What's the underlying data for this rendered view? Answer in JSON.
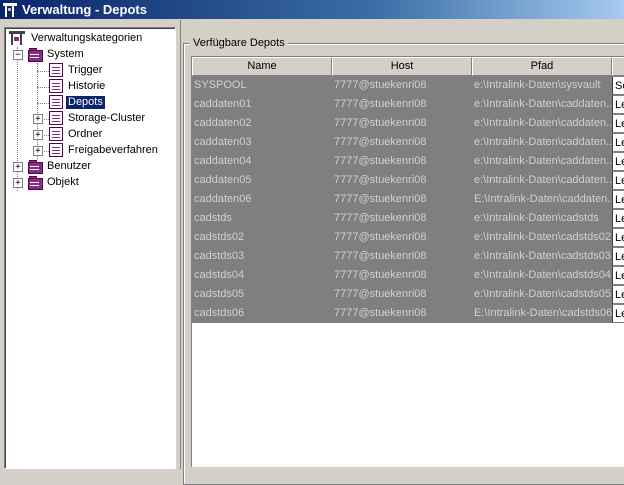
{
  "window": {
    "title": "Verwaltung - Depots"
  },
  "tree": {
    "root": "Verwaltungskategorien",
    "system": "System",
    "system_children": [
      "Trigger",
      "Historie",
      "Depots",
      "Storage-Cluster",
      "Ordner",
      "Freigabeverfahren"
    ],
    "selected": "Depots",
    "benutzer": "Benutzer",
    "objekt": "Objekt"
  },
  "group": {
    "title": "Verfügbare Depots"
  },
  "table": {
    "columns": [
      "Name",
      "Host",
      "Pfad"
    ],
    "rows": [
      {
        "name": "SYSPOOL",
        "host": "7777@stuekenri08",
        "pfad": "e:\\Intralink-Daten\\sysvault",
        "extra": "Sc"
      },
      {
        "name": "caddaten01",
        "host": "7777@stuekenri08",
        "pfad": "e:\\Intralink-Daten\\caddaten...",
        "extra": "Le"
      },
      {
        "name": "caddaten02",
        "host": "7777@stuekenri08",
        "pfad": "e:\\Intralink-Daten\\caddaten...",
        "extra": "Le"
      },
      {
        "name": "caddaten03",
        "host": "7777@stuekenri08",
        "pfad": "e:\\Intralink-Daten\\caddaten...",
        "extra": "Le"
      },
      {
        "name": "caddaten04",
        "host": "7777@stuekenri08",
        "pfad": "e:\\Intralink-Daten\\caddaten...",
        "extra": "Le"
      },
      {
        "name": "caddaten05",
        "host": "7777@stuekenri08",
        "pfad": "e:\\Intralink-Daten\\caddaten...",
        "extra": "Le"
      },
      {
        "name": "caddaten06",
        "host": "7777@stuekenri08",
        "pfad": "E:\\Intralink-Daten\\caddaten...",
        "extra": "Le"
      },
      {
        "name": "cadstds",
        "host": "7777@stuekenri08",
        "pfad": "e:\\Intralink-Daten\\cadstds",
        "extra": "Le"
      },
      {
        "name": "cadstds02",
        "host": "7777@stuekenri08",
        "pfad": "e:\\Intralink-Daten\\cadstds02",
        "extra": "Le"
      },
      {
        "name": "cadstds03",
        "host": "7777@stuekenri08",
        "pfad": "e:\\Intralink-Daten\\cadstds03",
        "extra": "Le"
      },
      {
        "name": "cadstds04",
        "host": "7777@stuekenri08",
        "pfad": "e:\\Intralink-Daten\\cadstds04",
        "extra": "Le"
      },
      {
        "name": "cadstds05",
        "host": "7777@stuekenri08",
        "pfad": "e:\\Intralink-Daten\\cadstds05",
        "extra": "Le"
      },
      {
        "name": "cadstds06",
        "host": "7777@stuekenri08",
        "pfad": "E:\\Intralink-Daten\\cadstds06",
        "extra": "Le"
      }
    ]
  },
  "colors": {
    "selection": "#0a246a",
    "row_fill": "#7f7f7f",
    "row_text": "#d4d0c8",
    "tree_icon": "#8a2c84"
  }
}
